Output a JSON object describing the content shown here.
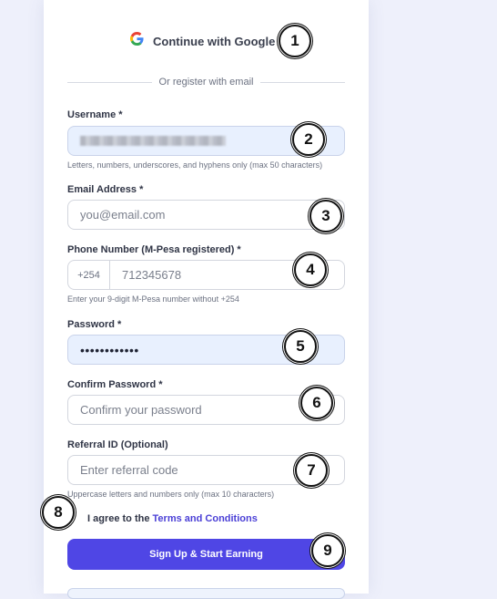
{
  "google": {
    "label": "Continue with Google",
    "icon": "google-icon"
  },
  "divider": {
    "text": "Or register with email"
  },
  "username": {
    "label": "Username *",
    "hint": "Letters, numbers, underscores, and hyphens only (max 50 characters)"
  },
  "email": {
    "label": "Email Address *",
    "placeholder": "you@email.com"
  },
  "phone": {
    "label": "Phone Number (M-Pesa registered) *",
    "prefix": "+254",
    "placeholder": "712345678",
    "hint": "Enter your 9-digit M-Pesa number without +254"
  },
  "password": {
    "label": "Password *",
    "value": "••••••••••••"
  },
  "confirm_password": {
    "label": "Confirm Password *",
    "placeholder": "Confirm your password"
  },
  "referral": {
    "label": "Referral ID (Optional)",
    "placeholder": "Enter referral code",
    "hint": "Uppercase letters and numbers only (max 10 characters)"
  },
  "terms": {
    "prefix": "I agree to the",
    "link": "Terms and Conditions"
  },
  "submit": {
    "label": "Sign Up & Start Earning"
  },
  "badges": [
    "1",
    "2",
    "3",
    "4",
    "5",
    "6",
    "7",
    "8",
    "9"
  ],
  "colors": {
    "accent": "#4f46e5",
    "background": "#eef0fb",
    "filled_field": "#e8f0fe"
  }
}
